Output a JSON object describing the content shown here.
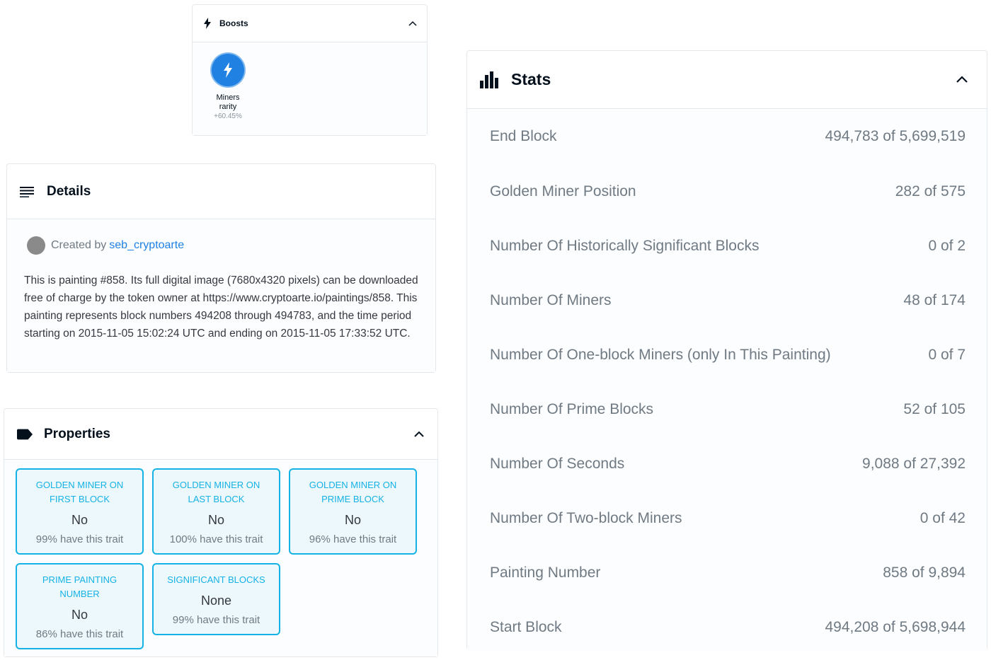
{
  "boosts": {
    "title": "Boosts",
    "items": [
      {
        "name": "Miners rarity",
        "value": "+60.45%",
        "icon": "lightning-icon"
      }
    ]
  },
  "details": {
    "title": "Details",
    "created_prefix": "Created by",
    "creator": "seb_cryptoarte",
    "description": "This is painting #858. Its full digital image (7680x4320 pixels) can be downloaded free of charge by the token owner at https://www.cryptoarte.io/paintings/858. This painting represents block numbers 494208 through 494783, and the time period starting on 2015-11-05 15:02:24 UTC and ending on 2015-11-05 17:33:52 UTC."
  },
  "properties": {
    "title": "Properties",
    "traits": [
      {
        "type": "GOLDEN MINER ON FIRST BLOCK",
        "value": "No",
        "rarity": "99% have this trait"
      },
      {
        "type": "GOLDEN MINER ON LAST BLOCK",
        "value": "No",
        "rarity": "100% have this trait"
      },
      {
        "type": "GOLDEN MINER ON PRIME BLOCK",
        "value": "No",
        "rarity": "96% have this trait"
      },
      {
        "type": "PRIME PAINTING NUMBER",
        "value": "No",
        "rarity": "86% have this trait"
      },
      {
        "type": "SIGNIFICANT BLOCKS",
        "value": "None",
        "rarity": "99% have this trait"
      }
    ]
  },
  "stats": {
    "title": "Stats",
    "rows": [
      {
        "label": "End Block",
        "value": "494,783 of 5,699,519"
      },
      {
        "label": "Golden Miner Position",
        "value": "282 of 575"
      },
      {
        "label": "Number Of Historically Significant Blocks",
        "value": "0 of 2"
      },
      {
        "label": "Number Of Miners",
        "value": "48 of 174"
      },
      {
        "label": "Number Of One-block Miners (only In This Painting)",
        "value": "0 of 7"
      },
      {
        "label": "Number Of Prime Blocks",
        "value": "52 of 105"
      },
      {
        "label": "Number Of Seconds",
        "value": "9,088 of 27,392"
      },
      {
        "label": "Number Of Two-block Miners",
        "value": "0 of 42"
      },
      {
        "label": "Painting Number",
        "value": "858 of 9,894"
      },
      {
        "label": "Start Block",
        "value": "494,208 of 5,698,944"
      }
    ]
  },
  "colors": {
    "accent": "#2081e2",
    "trait_border": "#15b2e5",
    "muted_text": "#707a83"
  }
}
